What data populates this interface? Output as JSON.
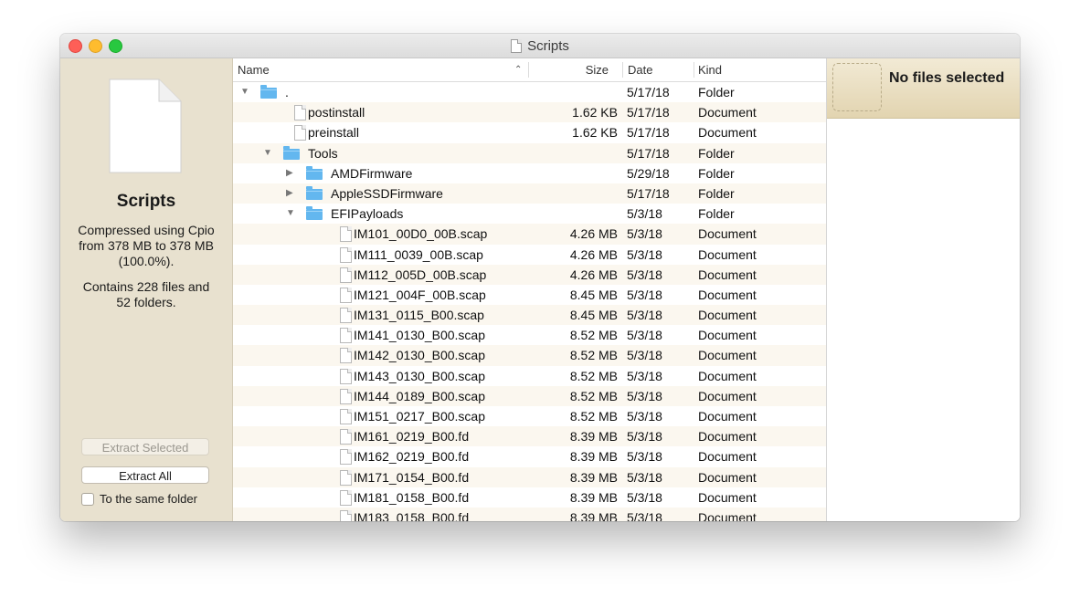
{
  "window": {
    "title": "Scripts"
  },
  "sidebar": {
    "archive_name": "Scripts",
    "info_line1": "Compressed using Cpio",
    "info_line2": "from 378 MB to 378 MB",
    "info_line3": "(100.0%).",
    "contents_line1": "Contains 228 files and",
    "contents_line2": "52 folders.",
    "extract_selected_label": "Extract Selected",
    "extract_all_label": "Extract All",
    "same_folder_label": "To the same folder"
  },
  "columns": {
    "name": "Name",
    "size": "Size",
    "date": "Date",
    "kind": "Kind"
  },
  "rows": [
    {
      "name": ".",
      "size": "",
      "date": "5/17/18",
      "kind": "Folder",
      "level": 0,
      "type": "folder",
      "state": "open"
    },
    {
      "name": "postinstall",
      "size": "1.62 KB",
      "date": "5/17/18",
      "kind": "Document",
      "level": 1,
      "type": "file",
      "state": ""
    },
    {
      "name": "preinstall",
      "size": "1.62 KB",
      "date": "5/17/18",
      "kind": "Document",
      "level": 1,
      "type": "file",
      "state": ""
    },
    {
      "name": "Tools",
      "size": "",
      "date": "5/17/18",
      "kind": "Folder",
      "level": 1,
      "type": "folder",
      "state": "open"
    },
    {
      "name": "AMDFirmware",
      "size": "",
      "date": "5/29/18",
      "kind": "Folder",
      "level": 2,
      "type": "folder",
      "state": "closed"
    },
    {
      "name": "AppleSSDFirmware",
      "size": "",
      "date": "5/17/18",
      "kind": "Folder",
      "level": 2,
      "type": "folder",
      "state": "closed"
    },
    {
      "name": "EFIPayloads",
      "size": "",
      "date": "5/3/18",
      "kind": "Folder",
      "level": 2,
      "type": "folder",
      "state": "open"
    },
    {
      "name": "IM101_00D0_00B.scap",
      "size": "4.26 MB",
      "date": "5/3/18",
      "kind": "Document",
      "level": 3,
      "type": "file",
      "state": ""
    },
    {
      "name": "IM111_0039_00B.scap",
      "size": "4.26 MB",
      "date": "5/3/18",
      "kind": "Document",
      "level": 3,
      "type": "file",
      "state": ""
    },
    {
      "name": "IM112_005D_00B.scap",
      "size": "4.26 MB",
      "date": "5/3/18",
      "kind": "Document",
      "level": 3,
      "type": "file",
      "state": ""
    },
    {
      "name": "IM121_004F_00B.scap",
      "size": "8.45 MB",
      "date": "5/3/18",
      "kind": "Document",
      "level": 3,
      "type": "file",
      "state": ""
    },
    {
      "name": "IM131_0115_B00.scap",
      "size": "8.45 MB",
      "date": "5/3/18",
      "kind": "Document",
      "level": 3,
      "type": "file",
      "state": ""
    },
    {
      "name": "IM141_0130_B00.scap",
      "size": "8.52 MB",
      "date": "5/3/18",
      "kind": "Document",
      "level": 3,
      "type": "file",
      "state": ""
    },
    {
      "name": "IM142_0130_B00.scap",
      "size": "8.52 MB",
      "date": "5/3/18",
      "kind": "Document",
      "level": 3,
      "type": "file",
      "state": ""
    },
    {
      "name": "IM143_0130_B00.scap",
      "size": "8.52 MB",
      "date": "5/3/18",
      "kind": "Document",
      "level": 3,
      "type": "file",
      "state": ""
    },
    {
      "name": "IM144_0189_B00.scap",
      "size": "8.52 MB",
      "date": "5/3/18",
      "kind": "Document",
      "level": 3,
      "type": "file",
      "state": ""
    },
    {
      "name": "IM151_0217_B00.scap",
      "size": "8.52 MB",
      "date": "5/3/18",
      "kind": "Document",
      "level": 3,
      "type": "file",
      "state": ""
    },
    {
      "name": "IM161_0219_B00.fd",
      "size": "8.39 MB",
      "date": "5/3/18",
      "kind": "Document",
      "level": 3,
      "type": "file",
      "state": ""
    },
    {
      "name": "IM162_0219_B00.fd",
      "size": "8.39 MB",
      "date": "5/3/18",
      "kind": "Document",
      "level": 3,
      "type": "file",
      "state": ""
    },
    {
      "name": "IM171_0154_B00.fd",
      "size": "8.39 MB",
      "date": "5/3/18",
      "kind": "Document",
      "level": 3,
      "type": "file",
      "state": ""
    },
    {
      "name": "IM181_0158_B00.fd",
      "size": "8.39 MB",
      "date": "5/3/18",
      "kind": "Document",
      "level": 3,
      "type": "file",
      "state": ""
    },
    {
      "name": "IM183_0158_B00.fd",
      "size": "8.39 MB",
      "date": "5/3/18",
      "kind": "Document",
      "level": 3,
      "type": "file",
      "state": ""
    }
  ],
  "preview": {
    "title": "No files selected"
  }
}
